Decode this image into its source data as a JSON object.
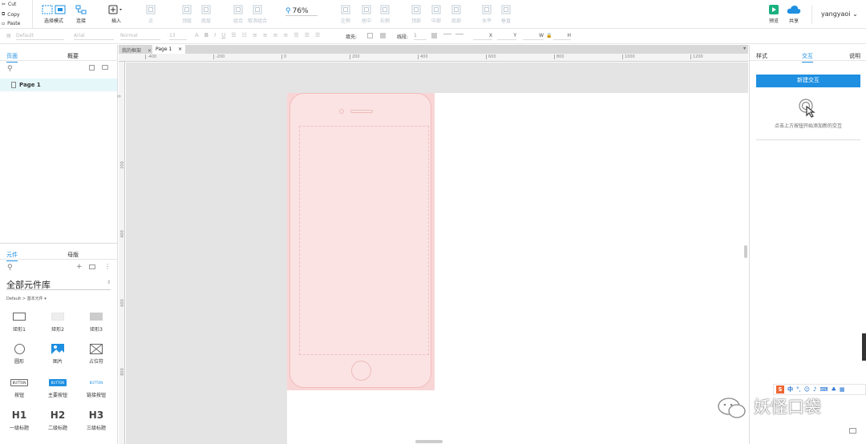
{
  "clipboard": {
    "cut": "Cut",
    "copy": "Copy",
    "paste": "Paste"
  },
  "toolbar": {
    "select_mode": "选择模式",
    "connect": "连接",
    "insert": "插入",
    "disabled_tools": [
      "点",
      "顶层",
      "底层",
      "组合",
      "取消组合",
      "左侧",
      "居中",
      "右侧",
      "顶部",
      "中部",
      "底部",
      "水平",
      "垂直"
    ],
    "zoom": "76%",
    "preview": "预览",
    "share": "共享",
    "user": "yangyaoi"
  },
  "format_bar": {
    "style": "Default",
    "font": "Arial",
    "weight": "Normal",
    "size": "13",
    "fill_label": "填充:",
    "line_label": "线段:",
    "line_value": "1",
    "x_label": "X",
    "y_label": "Y",
    "w_label": "W",
    "h_label": "H"
  },
  "left_panel": {
    "tabs": [
      "页面",
      "概要"
    ],
    "page_name": "Page 1",
    "lib_tabs": [
      "元件",
      "母版"
    ],
    "library_title": "全部元件库",
    "breadcrumb": "Default > 基本元件 ▾",
    "widgets": [
      {
        "label": "矩形1",
        "icon": "rect-outline"
      },
      {
        "label": "矩形2",
        "icon": "rect-light"
      },
      {
        "label": "矩形3",
        "icon": "rect-grey"
      },
      {
        "label": "圆形",
        "icon": "circle"
      },
      {
        "label": "图片",
        "icon": "image"
      },
      {
        "label": "占位符",
        "icon": "placeholder"
      },
      {
        "label": "按钮",
        "icon": "button"
      },
      {
        "label": "主要按钮",
        "icon": "primary-button"
      },
      {
        "label": "链接按钮",
        "icon": "link-button"
      },
      {
        "label": "一级标题",
        "icon": "h1"
      },
      {
        "label": "二级标题",
        "icon": "h2"
      },
      {
        "label": "三级标题",
        "icon": "h3"
      }
    ],
    "button_text": "BUTTON",
    "headings": [
      "H1",
      "H2",
      "H3"
    ]
  },
  "canvas": {
    "tabs": [
      "我的框架",
      "Page 1"
    ],
    "ruler_top": [
      "-400",
      "-200",
      "0",
      "200",
      "400",
      "600",
      "800",
      "1000",
      "1200"
    ],
    "ruler_left": [
      "0",
      "200",
      "400",
      "600",
      "800"
    ]
  },
  "right_panel": {
    "tabs": [
      "样式",
      "交互",
      "说明"
    ],
    "new_interaction": "新建交互",
    "hint": "点击上方按钮开始添加新的交互"
  },
  "tray": {
    "lang": "中"
  },
  "watermark": "妖怪口袋",
  "colors": {
    "accent": "#1e8fe1",
    "phone_fill": "#f8d6d6",
    "selected_row": "#e6f7fa"
  }
}
